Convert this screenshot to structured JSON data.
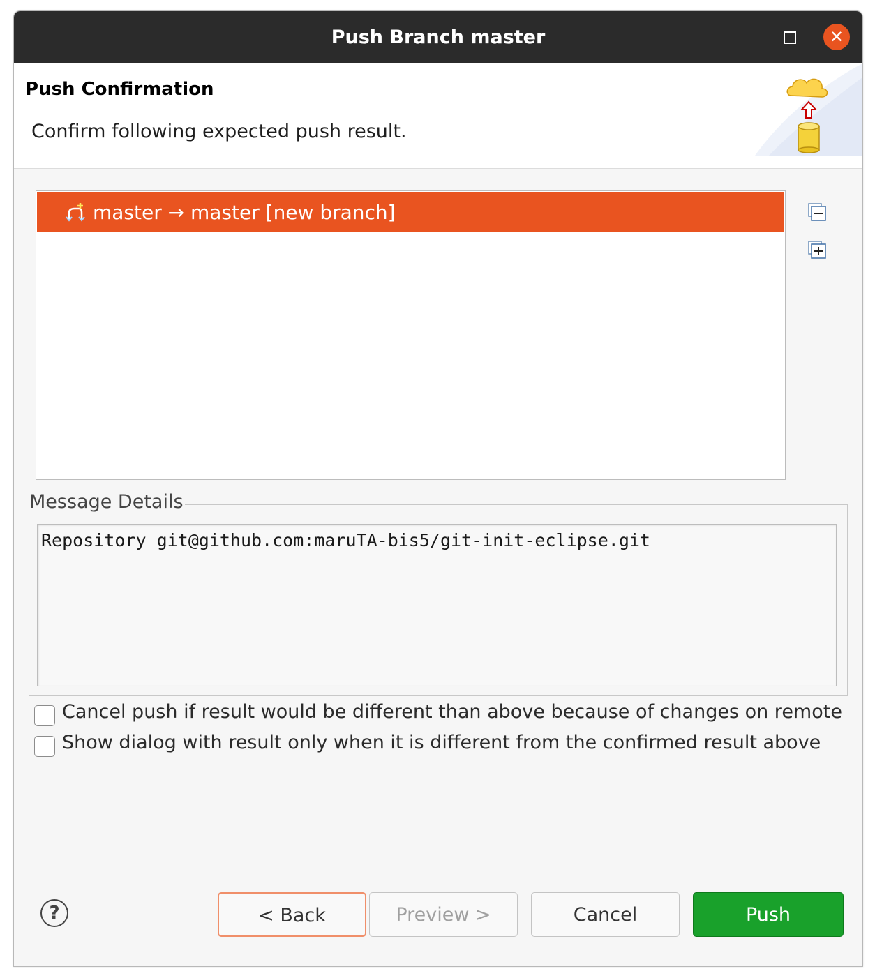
{
  "window": {
    "title": "Push Branch master"
  },
  "banner": {
    "title": "Push Confirmation",
    "message": "Confirm following expected push result."
  },
  "tree": {
    "rows": [
      {
        "label": "master → master [new branch]",
        "selected": true,
        "icon": "branch-new-icon"
      }
    ],
    "collapse_icon": "collapse-all-icon",
    "expand_icon": "expand-all-icon"
  },
  "details": {
    "legend": "Message Details",
    "text": "Repository git@github.com:maruTA-bis5/git-init-eclipse.git"
  },
  "options": {
    "cancel_if_different": {
      "label": "Cancel push if result would be different than above because of changes on remote",
      "checked": false
    },
    "show_only_if_different": {
      "label": "Show dialog with result only when it is different from the confirmed result above",
      "checked": false
    }
  },
  "buttons": {
    "help": "?",
    "back": "< Back",
    "preview": "Preview >",
    "cancel": "Cancel",
    "push": "Push"
  },
  "colors": {
    "selection": "#e95420",
    "push_button": "#19a12b",
    "titlebar": "#2b2b2b"
  }
}
